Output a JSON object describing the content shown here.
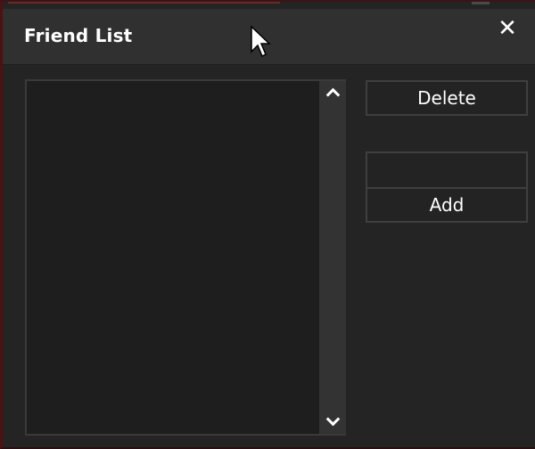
{
  "window": {
    "title": "Friend List",
    "close_glyph": "✕"
  },
  "actions": {
    "delete_label": "Delete",
    "add_label": "Add"
  },
  "friend_input": {
    "value": "",
    "placeholder": ""
  },
  "friend_list": {
    "items": []
  },
  "colors": {
    "window_bg": "#242424",
    "titlebar_bg": "#303030",
    "list_bg": "#1e1e1e",
    "scrollbar_bg": "#333333",
    "accent": "#6a2a2c",
    "text": "#ffffff"
  }
}
